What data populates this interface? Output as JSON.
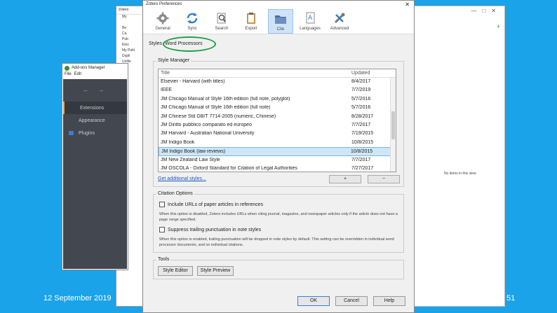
{
  "footer": {
    "date": "12 September 2019",
    "page": "51"
  },
  "bg_window": {
    "title": "Zotero",
    "rows": [
      "My",
      "",
      "Be",
      "Ca",
      "Pub",
      "Elev",
      "My Publ",
      "Dupli",
      "Unfile"
    ]
  },
  "right_window": {
    "message": "No items in this view"
  },
  "addons": {
    "title": "Add-ons Manager",
    "menu": [
      "File",
      "Edit"
    ],
    "nav": "← →",
    "items": [
      "Extensions",
      "Appearance",
      "Plugins"
    ]
  },
  "prefs": {
    "title": "Zotero Preferences",
    "close": "✕",
    "toolbar": [
      "General",
      "Sync",
      "Search",
      "Export",
      "Cite",
      "Languages",
      "Advanced"
    ],
    "subtabs": {
      "styles": "Styles",
      "word": "Word Processors"
    },
    "style_manager": {
      "legend": "Style Manager",
      "col_title": "Title",
      "col_updated": "Updated",
      "rows": [
        {
          "title": "Elsevier - Harvard (with titles)",
          "updated": "8/4/2017"
        },
        {
          "title": "IEEE",
          "updated": "7/7/2019"
        },
        {
          "title": "JM Chicago Manual of Style 16th edition (full note, polyglot)",
          "updated": "5/7/2016"
        },
        {
          "title": "JM Chicago Manual of Style 16th edition (full note)",
          "updated": "5/7/2016"
        },
        {
          "title": "JM Chinese Std GB/T 7714-2005 (numeric, Chinese)",
          "updated": "8/28/2017"
        },
        {
          "title": "JM Diritto pubblico comparato ed europeo",
          "updated": "7/7/2017"
        },
        {
          "title": "JM Harvard - Australian National University",
          "updated": "7/19/2015"
        },
        {
          "title": "JM Indigo Book",
          "updated": "10/8/2015"
        },
        {
          "title": "JM Indigo Book (law reviews)",
          "updated": "10/8/2015"
        },
        {
          "title": "JM New Zealand Law Style",
          "updated": "7/7/2017"
        },
        {
          "title": "JM OSCOLA - Oxford Standard for Citation of Legal Authorities",
          "updated": "7/27/2017"
        }
      ],
      "get_more": "Get additional styles...",
      "btn1": "+",
      "btn2": "−"
    },
    "citation": {
      "legend": "Citation Options",
      "opt1": "Include URLs of paper articles in references",
      "note1": "When this option is disabled, Zotero includes URLs when citing journal, magazine, and newspaper articles only if the article does not have a page range specified.",
      "opt2": "Suppress trailing punctuation in note styles",
      "note2": "When this option is enabled, trailing punctuation will be dropped in note styles by default. This setting can be overridden in individual word processor documents, and on individual citations."
    },
    "tools": {
      "legend": "Tools",
      "editor": "Style Editor",
      "preview": "Style Preview"
    },
    "buttons": {
      "ok": "OK",
      "cancel": "Cancel",
      "help": "Help"
    }
  }
}
